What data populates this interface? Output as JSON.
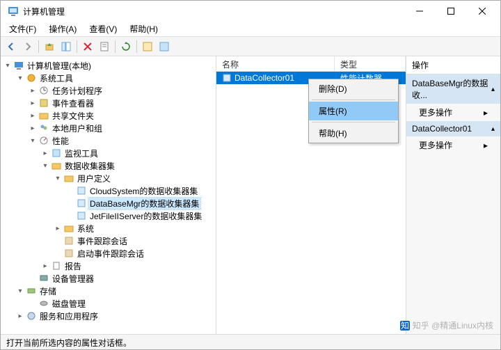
{
  "window": {
    "title": "计算机管理"
  },
  "menu": {
    "file": "文件(F)",
    "action": "操作(A)",
    "view": "查看(V)",
    "help": "帮助(H)"
  },
  "tree": {
    "root": "计算机管理(本地)",
    "systemTools": "系统工具",
    "taskScheduler": "任务计划程序",
    "eventViewer": "事件查看器",
    "sharedFolders": "共享文件夹",
    "localUsers": "本地用户和组",
    "performance": "性能",
    "monitor": "监视工具",
    "dataCollectorSets": "数据收集器集",
    "userDefined": "用户定义",
    "cloudSystem": "CloudSystem的数据收集器集",
    "databaseMgr": "DataBaseMgr的数据收集器集",
    "jetFile": "JetFileIIServer的数据收集器集",
    "system": "系统",
    "eventTrace": "事件跟踪会话",
    "startupEventTrace": "启动事件跟踪会话",
    "reports": "报告",
    "deviceManager": "设备管理器",
    "storage": "存储",
    "diskManagement": "磁盘管理",
    "services": "服务和应用程序"
  },
  "list": {
    "cols": {
      "name": "名称",
      "type": "类型"
    },
    "rows": [
      {
        "name": "DataCollector01",
        "type": "性能计数器"
      }
    ]
  },
  "actions": {
    "title": "操作",
    "group1": "DataBaseMgr的数据收...",
    "more": "更多操作",
    "group2": "DataCollector01"
  },
  "contextMenu": {
    "delete": "删除(D)",
    "properties": "属性(R)",
    "help": "帮助(H)"
  },
  "status": "打开当前所选内容的属性对话框。",
  "watermark": "知乎 @精通Linux内核"
}
